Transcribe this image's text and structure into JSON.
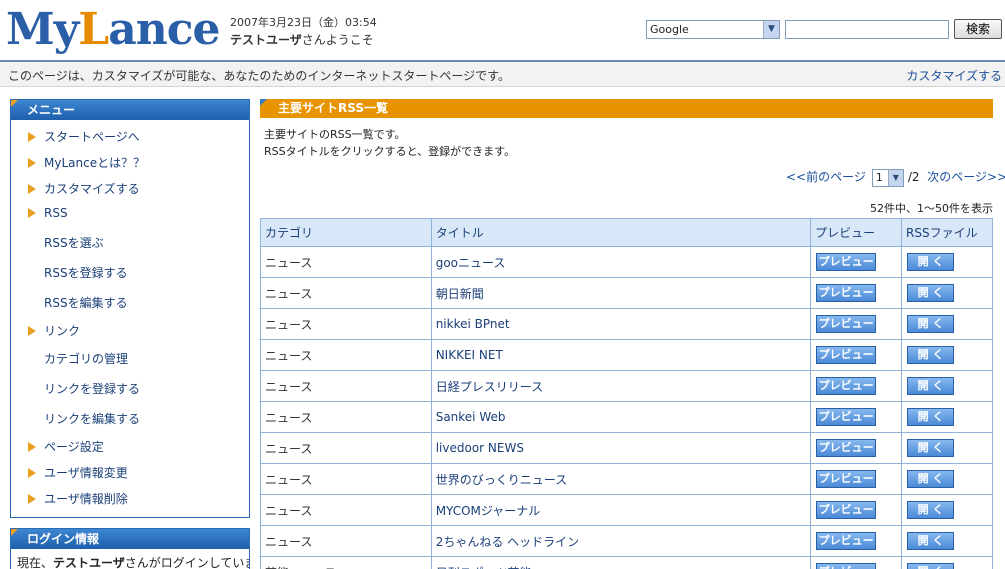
{
  "header": {
    "logo_main": "My",
    "logo_accent": "L",
    "logo_rest": "ance",
    "datetime": "2007年3月23日（金）03:54",
    "user_name": "テストユーザ",
    "welcome_suffix": "さんようこそ",
    "search_engine": "Google",
    "search_button": "検索"
  },
  "infobar": {
    "message": "このページは、カスタマイズが可能な、あなたのためのインターネットスタートページです。",
    "customize_link": "カスタマイズする"
  },
  "sidebar": {
    "menu_title": "メニュー",
    "items": [
      {
        "label": "スタートページへ",
        "level": "top"
      },
      {
        "label": "MyLanceとは？？",
        "level": "top"
      },
      {
        "label": "カスタマイズする",
        "level": "top"
      },
      {
        "label": "RSS",
        "level": "top"
      },
      {
        "label": "RSSを選ぶ",
        "level": "sub"
      },
      {
        "label": "RSSを登録する",
        "level": "sub"
      },
      {
        "label": "RSSを編集する",
        "level": "sub"
      },
      {
        "label": "リンク",
        "level": "top"
      },
      {
        "label": "カテゴリの管理",
        "level": "sub"
      },
      {
        "label": "リンクを登録する",
        "level": "sub"
      },
      {
        "label": "リンクを編集する",
        "level": "sub"
      },
      {
        "label": "ページ設定",
        "level": "top"
      },
      {
        "label": "ユーザ情報変更",
        "level": "top"
      },
      {
        "label": "ユーザ情報削除",
        "level": "top"
      }
    ],
    "login_title": "ログイン情報",
    "login_prefix": "現在、",
    "login_user": "テストユーザ",
    "login_suffix": "さんがログインしていま"
  },
  "main": {
    "section_title": "主要サイトRSS一覧",
    "description_1": "主要サイトのRSS一覧です。",
    "description_2": "RSSタイトルをクリックすると、登録ができます。",
    "pager": {
      "prev": "<<前のページ",
      "current": "1",
      "total": "/2",
      "next": "次のページ>>"
    },
    "count_text": "52件中、1〜50件を表示",
    "table": {
      "headers": [
        "カテゴリ",
        "タイトル",
        "プレビュー",
        "RSSファイル"
      ],
      "preview_label": "プレビュー",
      "open_label": "開 く",
      "rows": [
        {
          "category": "ニュース",
          "title": "gooニュース"
        },
        {
          "category": "ニュース",
          "title": "朝日新聞"
        },
        {
          "category": "ニュース",
          "title": "nikkei BPnet"
        },
        {
          "category": "ニュース",
          "title": "NIKKEI NET"
        },
        {
          "category": "ニュース",
          "title": "日経プレスリリース"
        },
        {
          "category": "ニュース",
          "title": "Sankei Web"
        },
        {
          "category": "ニュース",
          "title": "livedoor NEWS"
        },
        {
          "category": "ニュース",
          "title": "世界のびっくりニュース"
        },
        {
          "category": "ニュース",
          "title": "MYCOMジャーナル"
        },
        {
          "category": "ニュース",
          "title": "2ちゃんねる ヘッドライン"
        },
        {
          "category": "芸能ニュース",
          "title": "日刊スポーツ芸能"
        }
      ]
    }
  }
}
